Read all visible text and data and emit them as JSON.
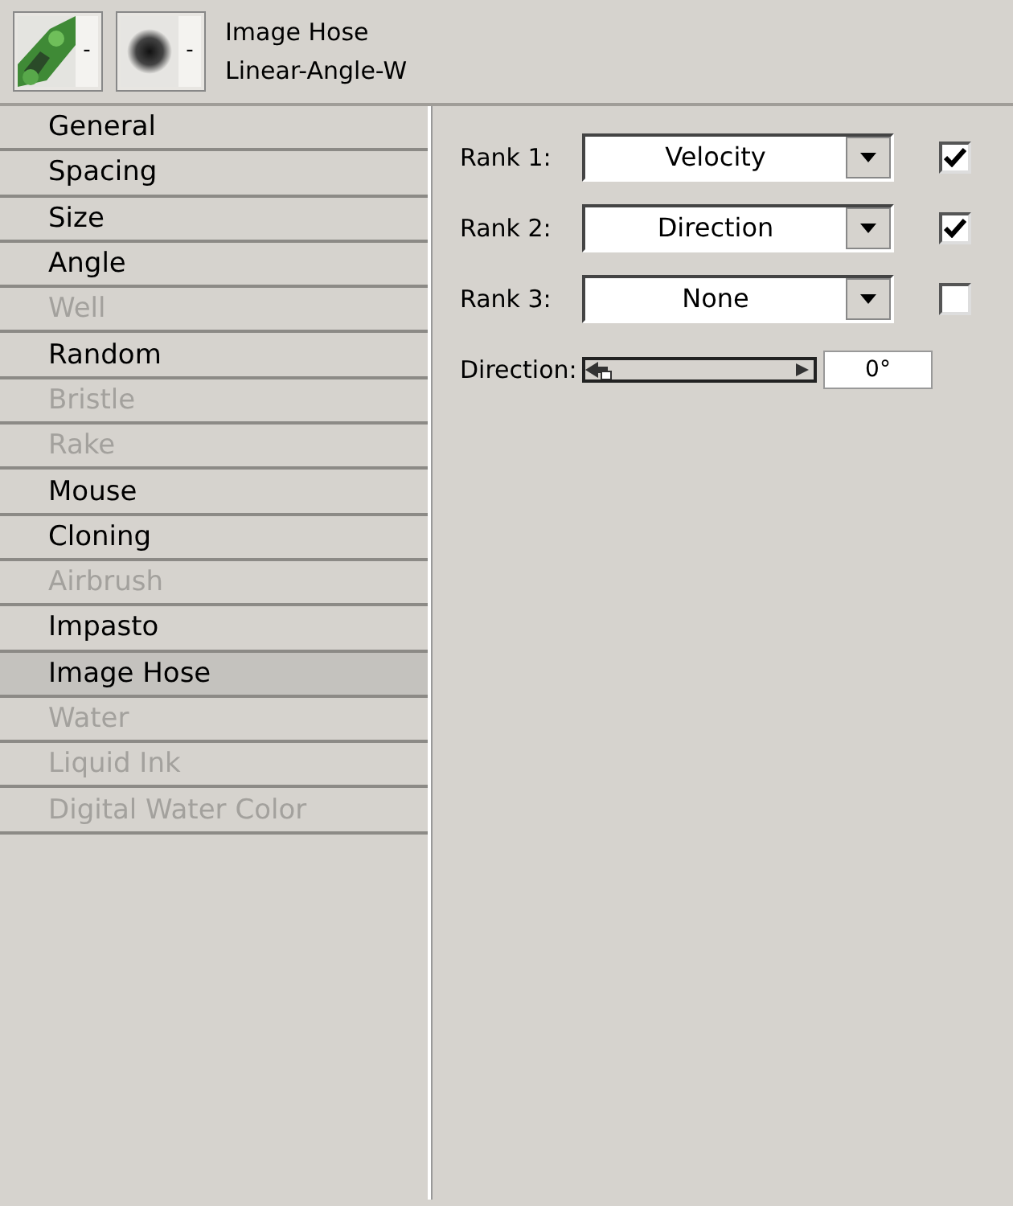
{
  "header": {
    "variant_button": "-",
    "dab_button": "-",
    "category": "Image Hose",
    "variant": "Linear-Angle-W"
  },
  "sections": [
    {
      "label": "General",
      "disabled": false,
      "selected": false
    },
    {
      "label": "Spacing",
      "disabled": false,
      "selected": false
    },
    {
      "label": "Size",
      "disabled": false,
      "selected": false
    },
    {
      "label": "Angle",
      "disabled": false,
      "selected": false
    },
    {
      "label": "Well",
      "disabled": true,
      "selected": false
    },
    {
      "label": "Random",
      "disabled": false,
      "selected": false
    },
    {
      "label": "Bristle",
      "disabled": true,
      "selected": false
    },
    {
      "label": "Rake",
      "disabled": true,
      "selected": false
    },
    {
      "label": "Mouse",
      "disabled": false,
      "selected": false
    },
    {
      "label": "Cloning",
      "disabled": false,
      "selected": false
    },
    {
      "label": "Airbrush",
      "disabled": true,
      "selected": false
    },
    {
      "label": "Impasto",
      "disabled": false,
      "selected": false
    },
    {
      "label": "Image Hose",
      "disabled": false,
      "selected": true
    },
    {
      "label": "Water",
      "disabled": true,
      "selected": false
    },
    {
      "label": "Liquid Ink",
      "disabled": true,
      "selected": false
    },
    {
      "label": "Digital Water Color",
      "disabled": true,
      "selected": false
    }
  ],
  "ranks": [
    {
      "label": "Rank 1:",
      "value": "Velocity",
      "checked": true
    },
    {
      "label": "Rank 2:",
      "value": "Direction",
      "checked": true
    },
    {
      "label": "Rank 3:",
      "value": "None",
      "checked": false
    }
  ],
  "direction": {
    "label": "Direction:",
    "level": 0,
    "reading": "0°"
  }
}
